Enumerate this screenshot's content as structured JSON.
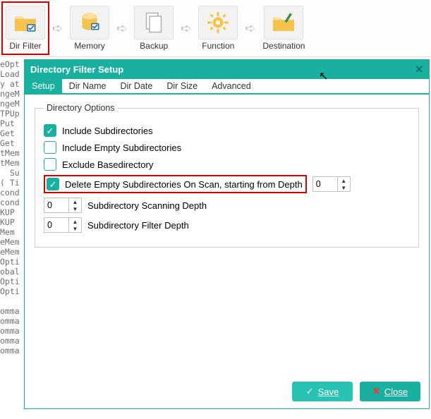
{
  "toolbar": {
    "items": [
      {
        "label": "Dir Filter"
      },
      {
        "label": "Memory"
      },
      {
        "label": "Backup"
      },
      {
        "label": "Function"
      },
      {
        "label": "Destination"
      }
    ]
  },
  "ghost_code": "eOpt\nLoad\ny at\nngeM\nngeM\nTPUp\nPut \nGet \nGet \ntMem\ntMem\n  Su\n( Ti\ncond\ncond\nKUP \nKUP \nMem\neMem\neMem\nOpti\nobal\nOpti\nOpti\n\nomma\nomma\nomma\nomma\nomma",
  "dialog": {
    "title": "Directory Filter Setup",
    "tabs": [
      "Setup",
      "Dir Name",
      "Dir Date",
      "Dir Size",
      "Advanced"
    ],
    "active_tab_index": 0,
    "group_legend": "Directory Options",
    "options": {
      "include_sub": {
        "label": "Include Subdirectories",
        "checked": true
      },
      "include_empty": {
        "label": "Include Empty Subdirectories",
        "checked": false
      },
      "exclude_base": {
        "label": "Exclude Basedirectory",
        "checked": false
      },
      "delete_empty": {
        "label": "Delete Empty Subdirectories On Scan, starting from Depth",
        "checked": true,
        "value": "0"
      },
      "scan_depth": {
        "label": "Subdirectory Scanning Depth",
        "value": "0"
      },
      "filter_depth": {
        "label": "Subdirectory Filter Depth",
        "value": "0"
      }
    },
    "buttons": {
      "save": "Save",
      "close": "Close"
    }
  }
}
